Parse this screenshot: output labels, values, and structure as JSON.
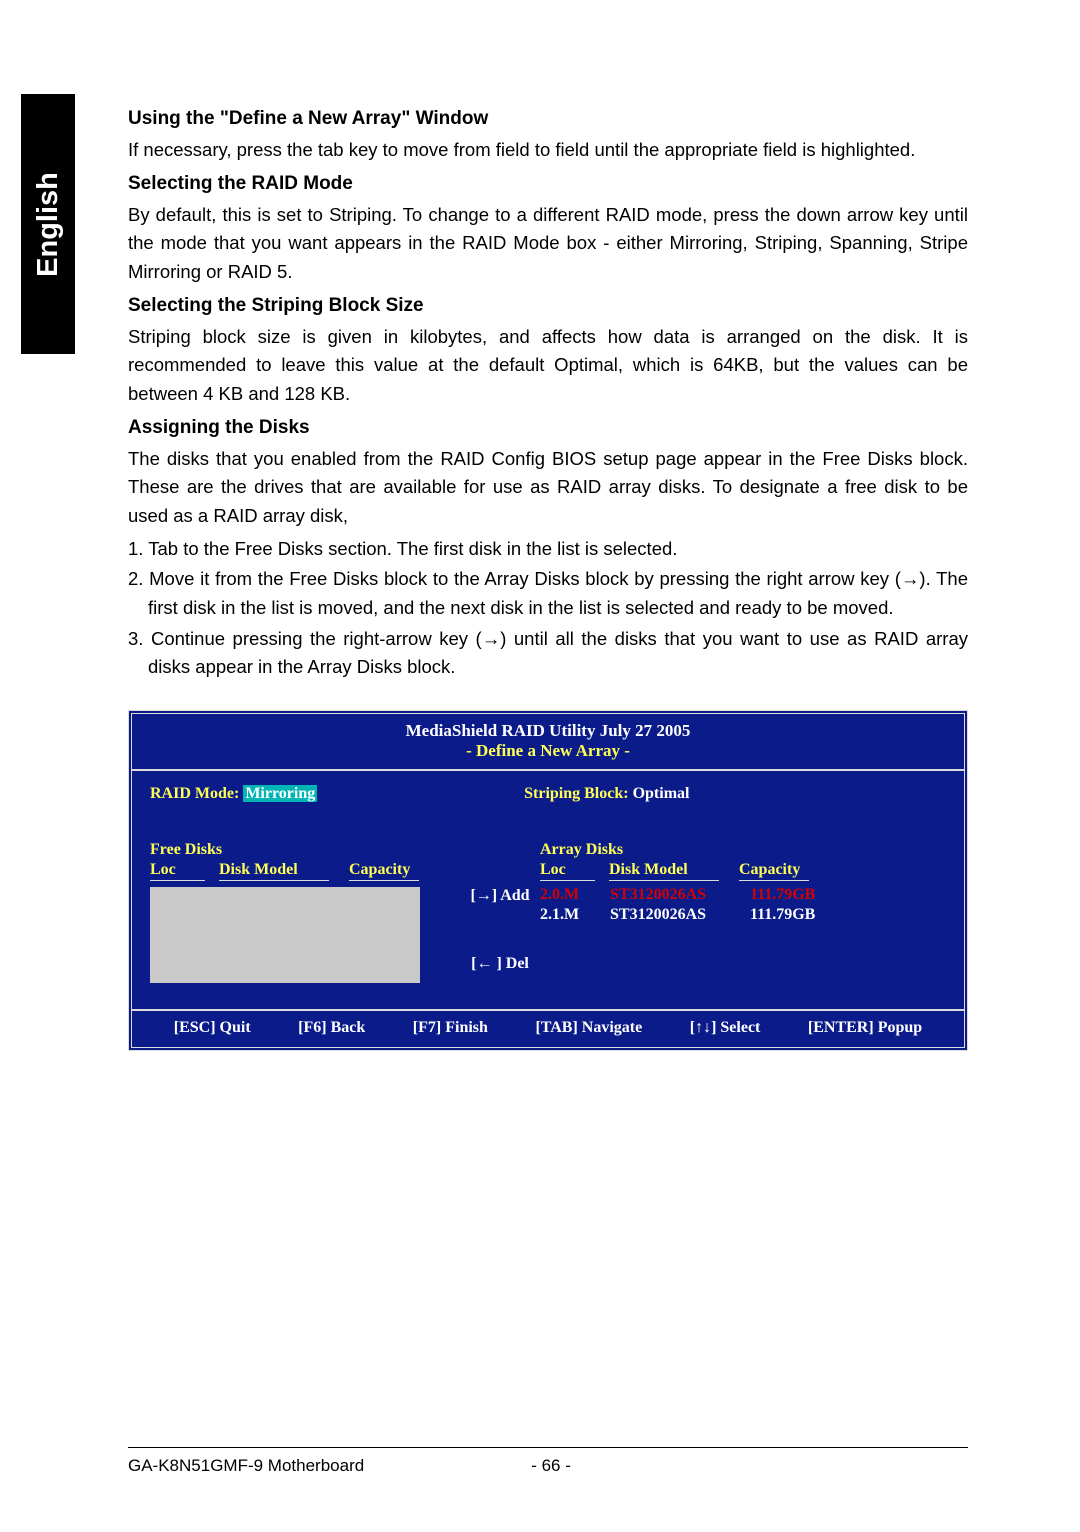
{
  "language": "English",
  "sections": {
    "h1": "Using the \"Define a New Array\" Window",
    "p1": "If necessary, press the tab key to move from field to field until the appropriate field is highlighted.",
    "h2": "Selecting the RAID Mode",
    "p2": "By default, this is set to Striping. To change to a different RAID mode, press the down arrow key until the mode that you want appears in the RAID Mode box - either Mirroring, Striping, Spanning, Stripe Mirroring or RAID 5.",
    "h3": "Selecting the Striping Block Size",
    "p3": "Striping block size is given in kilobytes, and affects how data is arranged on the disk. It is recommended to leave this value at the default Optimal, which is 64KB, but the values can be between 4 KB and 128 KB.",
    "h4": "Assigning the Disks",
    "p4": "The disks that you enabled from the RAID Config BIOS setup page appear in the Free Disks block. These are the drives that are available for use as RAID array disks. To designate a free disk to be used as a RAID array disk,",
    "li1": "1. Tab to the Free Disks section. The first disk in the list is selected.",
    "li2": "2. Move it from the Free Disks block to the Array Disks block by pressing the right arrow key (→). The first disk in the list is moved, and the next disk in the list is selected and ready to be moved.",
    "li3": "3. Continue pressing the right-arrow key (→) until all the disks that you want to use as RAID array disks appear in the Array Disks block."
  },
  "raid": {
    "title": "MediaShield RAID Utility  July 27 2005",
    "subtitle": "- Define a New Array -",
    "raid_mode_label": "RAID Mode:",
    "raid_mode_value": "Mirroring",
    "striping_block_label": "Striping Block:",
    "striping_block_value": "Optimal",
    "free_disks_label": "Free Disks",
    "array_disks_label": "Array Disks",
    "headers": {
      "loc": "Loc",
      "model": "Disk Model",
      "capacity": "Capacity"
    },
    "add": "[→] Add",
    "del": "[← ] Del",
    "array_rows": [
      {
        "loc": "2.0.M",
        "model": "ST3120026AS",
        "capacity": "111.79GB",
        "highlight": true
      },
      {
        "loc": "2.1.M",
        "model": "ST3120026AS",
        "capacity": "111.79GB",
        "highlight": false
      }
    ],
    "footer": {
      "quit": "[ESC] Quit",
      "back": "[F6] Back",
      "finish": "[F7] Finish",
      "navigate": "[TAB] Navigate",
      "select": "[↑↓] Select",
      "popup": "[ENTER] Popup"
    }
  },
  "page_footer": {
    "model": "GA-K8N51GMF-9 Motherboard",
    "page": "- 66 -"
  }
}
